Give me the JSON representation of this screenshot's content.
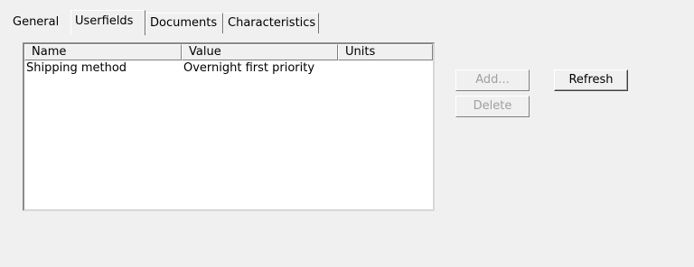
{
  "tabs": [
    {
      "label": "General",
      "selected": false
    },
    {
      "label": "Userfields",
      "selected": true
    },
    {
      "label": "Documents",
      "selected": false
    },
    {
      "label": "Characteristics",
      "selected": false
    }
  ],
  "userfields": {
    "columns": [
      "Name",
      "Value",
      "Units"
    ],
    "rows": [
      {
        "name": "Shipping method",
        "value": "Overnight first priority",
        "units": ""
      }
    ]
  },
  "buttons": {
    "add_label": "Add...",
    "add_enabled": false,
    "delete_label": "Delete",
    "delete_enabled": false,
    "refresh_label": "Refresh",
    "refresh_enabled": true
  }
}
